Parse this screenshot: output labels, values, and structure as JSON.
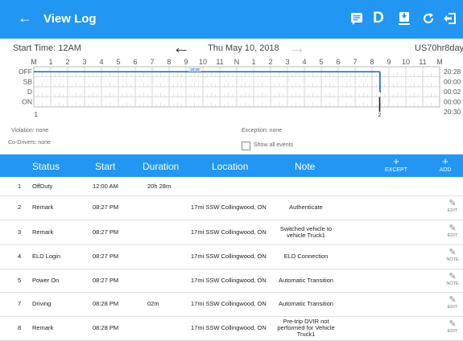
{
  "header": {
    "title": "View Log",
    "actions": [
      "document-icon",
      "D",
      "download-icon",
      "refresh-icon",
      "logout-icon"
    ],
    "action_d": "D"
  },
  "subheader": {
    "start_time": "Start Time: 12AM",
    "date": "Thu May 10, 2018",
    "rule": "US70hr8days"
  },
  "graph": {
    "hour_labels": [
      "M",
      "1",
      "2",
      "3",
      "4",
      "5",
      "6",
      "7",
      "8",
      "9",
      "10",
      "11",
      "N",
      "1",
      "2",
      "3",
      "4",
      "5",
      "6",
      "7",
      "8",
      "9",
      "10",
      "11",
      "M"
    ],
    "status_labels": [
      "OFF",
      "SB",
      "D",
      "ON"
    ],
    "totals": [
      "20:28",
      "00:00",
      "00:02",
      "00:00"
    ],
    "total_sum": "20:30",
    "below_label": "1",
    "marker_label": "2",
    "current_marker": "20:28",
    "segments": [
      {
        "status": "OFF",
        "start_hour": 0,
        "end_hour": 20.47
      },
      {
        "status": "D",
        "start_hour": 20.47,
        "end_hour": 20.5
      }
    ]
  },
  "info": {
    "violation": "Violation: none",
    "exception": "Exception: none",
    "co_drivers": "Co-Drivers: none",
    "show_all_events": "Show all events"
  },
  "table": {
    "headers": [
      "Status",
      "Start",
      "Duration",
      "Location",
      "Note"
    ],
    "except_label": "EXCEPT",
    "add_label": "ADD",
    "rows": [
      {
        "num": "1",
        "status": "OffDuty",
        "start": "12:00 AM",
        "duration": "20h 28m",
        "location": "",
        "note": "",
        "action": ""
      },
      {
        "num": "2",
        "status": "Remark",
        "start": "08:27 PM",
        "duration": "",
        "location": "17mi SSW Collingwood, ON",
        "note": "Authenticate",
        "action": "EDIT"
      },
      {
        "num": "3",
        "status": "Remark",
        "start": "08:27 PM",
        "duration": "",
        "location": "17mi SSW Collingwood, ON",
        "note": "Switched vehicle to vehicle Truck1",
        "action": "EDIT"
      },
      {
        "num": "4",
        "status": "ELD Login",
        "start": "08:27 PM",
        "duration": "",
        "location": "17mi SSW Collingwood, ON",
        "note": "ELD Connection",
        "action": "NOTE"
      },
      {
        "num": "5",
        "status": "Power On",
        "start": "08:27 PM",
        "duration": "",
        "location": "17mi SSW Collingwood, ON",
        "note": "Automatic Transition",
        "action": "NOTE"
      },
      {
        "num": "7",
        "status": "Driving",
        "start": "08:28 PM",
        "duration": "02m",
        "location": "17mi SSW Collingwood, ON",
        "note": "Automatic Transition",
        "action": "EDIT"
      },
      {
        "num": "8",
        "status": "Remark",
        "start": "08:28 PM",
        "duration": "",
        "location": "17mi SSW Collingwood, ON",
        "note": "Pre-trip DVIR not performed for Vehicle Truck1",
        "action": "EDIT"
      }
    ]
  },
  "colors": {
    "primary": "#2196f3",
    "status_line": "#1565c0",
    "grid": "#b5b5b5"
  }
}
